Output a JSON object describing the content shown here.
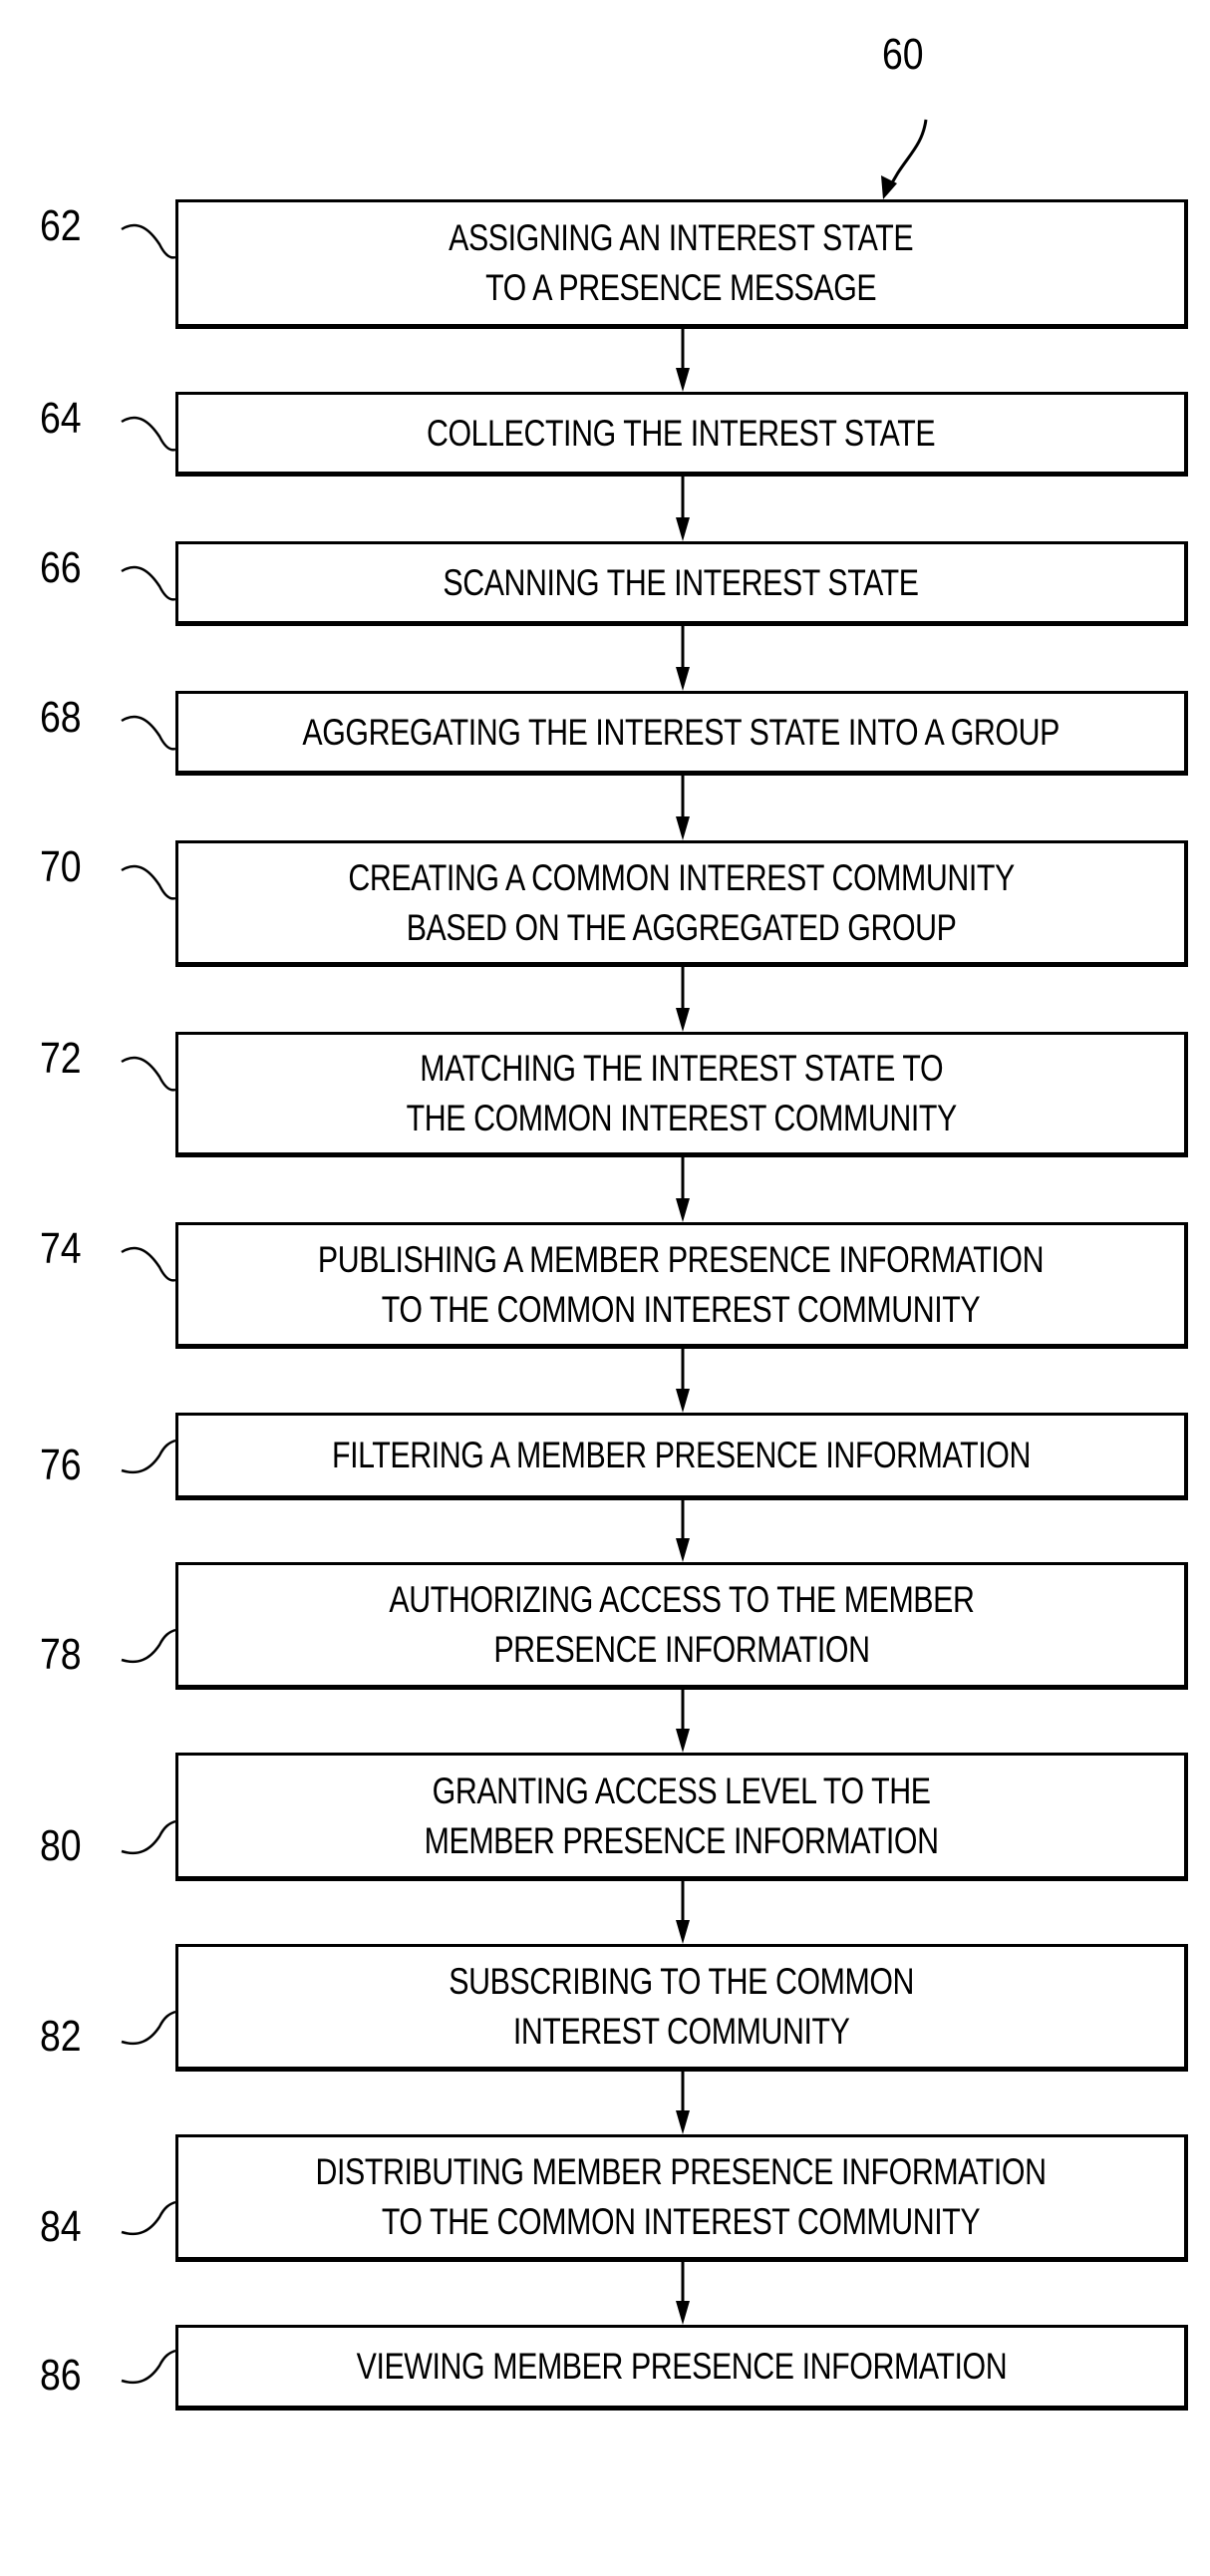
{
  "figure_ref": "60",
  "steps": [
    {
      "ref": "62",
      "text": "ASSIGNING AN INTEREST STATE\nTO A PRESENCE MESSAGE"
    },
    {
      "ref": "64",
      "text": "COLLECTING THE INTEREST STATE"
    },
    {
      "ref": "66",
      "text": "SCANNING THE INTEREST STATE"
    },
    {
      "ref": "68",
      "text": "AGGREGATING THE INTEREST STATE INTO A GROUP"
    },
    {
      "ref": "70",
      "text": "CREATING A COMMON INTEREST COMMUNITY\nBASED ON THE AGGREGATED GROUP"
    },
    {
      "ref": "72",
      "text": "MATCHING THE INTEREST STATE TO\nTHE COMMON INTEREST COMMUNITY"
    },
    {
      "ref": "74",
      "text": "PUBLISHING A MEMBER PRESENCE INFORMATION\nTO THE COMMON INTEREST COMMUNITY"
    },
    {
      "ref": "76",
      "text": "FILTERING A MEMBER PRESENCE INFORMATION"
    },
    {
      "ref": "78",
      "text": "AUTHORIZING ACCESS TO THE MEMBER\nPRESENCE INFORMATION"
    },
    {
      "ref": "80",
      "text": "GRANTING ACCESS LEVEL TO THE\nMEMBER PRESENCE INFORMATION"
    },
    {
      "ref": "82",
      "text": "SUBSCRIBING TO THE COMMON\nINTEREST COMMUNITY"
    },
    {
      "ref": "84",
      "text": "DISTRIBUTING MEMBER PRESENCE INFORMATION\nTO THE COMMON INTEREST COMMUNITY"
    },
    {
      "ref": "86",
      "text": "VIEWING MEMBER PRESENCE INFORMATION"
    }
  ]
}
